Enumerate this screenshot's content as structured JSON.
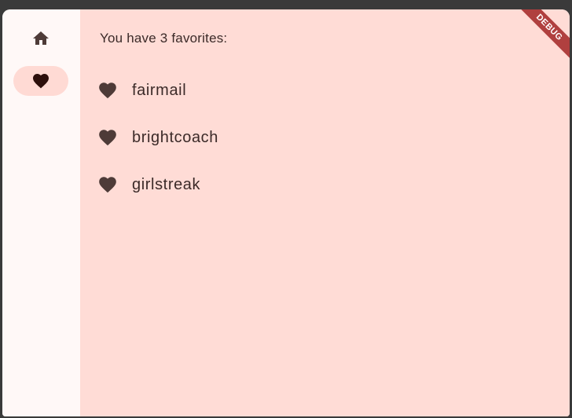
{
  "rail": {
    "destinations": [
      {
        "label": "Home",
        "icon": "home-icon",
        "selected": false
      },
      {
        "label": "Favorites",
        "icon": "heart-icon",
        "selected": true
      }
    ]
  },
  "main": {
    "count_text": "You have 3 favorites:",
    "favorites": [
      {
        "label": "fairmail",
        "icon": "heart-icon"
      },
      {
        "label": "brightcoach",
        "icon": "heart-icon"
      },
      {
        "label": "girlstreak",
        "icon": "heart-icon"
      }
    ]
  },
  "banner": {
    "text": "DEBUG"
  },
  "colors": {
    "rail_bg": "#fff8f7",
    "content_bg": "#ffdcd6",
    "selected_pill": "#ffdad4",
    "icon": "#4e3b38",
    "text": "#3b2a28",
    "banner": "#b0403f"
  }
}
